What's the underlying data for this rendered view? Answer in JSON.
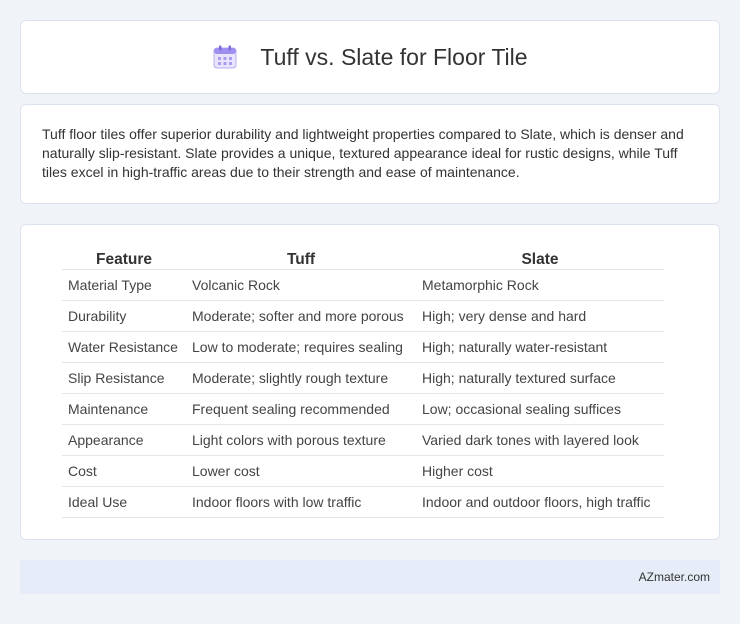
{
  "header": {
    "title": "Tuff vs. Slate for Floor Tile",
    "icon": "calendar-icon"
  },
  "summary": {
    "text": "Tuff floor tiles offer superior durability and lightweight properties compared to Slate, which is denser and naturally slip-resistant. Slate provides a unique, textured appearance ideal for rustic designs, while Tuff tiles excel in high-traffic areas due to their strength and ease of maintenance."
  },
  "table": {
    "headers": [
      "Feature",
      "Tuff",
      "Slate"
    ],
    "rows": [
      [
        "Material Type",
        "Volcanic Rock",
        "Metamorphic Rock"
      ],
      [
        "Durability",
        "Moderate; softer and more porous",
        "High; very dense and hard"
      ],
      [
        "Water Resistance",
        "Low to moderate; requires sealing",
        "High; naturally water-resistant"
      ],
      [
        "Slip Resistance",
        "Moderate; slightly rough texture",
        "High; naturally textured surface"
      ],
      [
        "Maintenance",
        "Frequent sealing recommended",
        "Low; occasional sealing suffices"
      ],
      [
        "Appearance",
        "Light colors with porous texture",
        "Varied dark tones with layered look"
      ],
      [
        "Cost",
        "Lower cost",
        "Higher cost"
      ],
      [
        "Ideal Use",
        "Indoor floors with low traffic",
        "Indoor and outdoor floors, high traffic"
      ]
    ]
  },
  "footer": {
    "brand": "AZmater.com"
  }
}
